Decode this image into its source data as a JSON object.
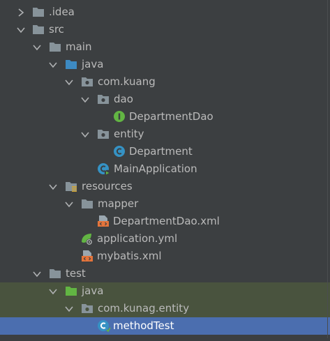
{
  "tree": {
    "items": [
      {
        "label": ".idea",
        "kind": "folder",
        "expanded": false
      },
      {
        "label": "src",
        "kind": "folder",
        "expanded": true
      },
      {
        "label": "main",
        "kind": "folder",
        "expanded": true
      },
      {
        "label": "java",
        "kind": "source-folder",
        "expanded": true
      },
      {
        "label": "com.kuang",
        "kind": "package",
        "expanded": true
      },
      {
        "label": "dao",
        "kind": "package",
        "expanded": true
      },
      {
        "label": "DepartmentDao",
        "kind": "interface"
      },
      {
        "label": "entity",
        "kind": "package",
        "expanded": true
      },
      {
        "label": "Department",
        "kind": "class"
      },
      {
        "label": "MainApplication",
        "kind": "spring-boot-class"
      },
      {
        "label": "resources",
        "kind": "resources-folder",
        "expanded": true
      },
      {
        "label": "mapper",
        "kind": "folder",
        "expanded": true
      },
      {
        "label": "DepartmentDao.xml",
        "kind": "xml-file"
      },
      {
        "label": "application.yml",
        "kind": "spring-config"
      },
      {
        "label": "mybatis.xml",
        "kind": "xml-file"
      },
      {
        "label": "test",
        "kind": "folder",
        "expanded": true
      },
      {
        "label": "java",
        "kind": "test-source-folder",
        "expanded": true
      },
      {
        "label": "com.kunag.entity",
        "kind": "package",
        "expanded": true
      },
      {
        "label": "methodTest",
        "kind": "class",
        "selected": true
      }
    ]
  },
  "colors": {
    "background": "#3c3f41",
    "text": "#bbbbbb",
    "selected_row": "#4b6eaf",
    "test_highlight": "#49533e",
    "folder_gray": "#87939a",
    "folder_blue": "#3d8ac2",
    "folder_green": "#62b543",
    "interface_green": "#62b543",
    "class_blue": "#3592c4",
    "xml_orange": "#e4743b"
  }
}
